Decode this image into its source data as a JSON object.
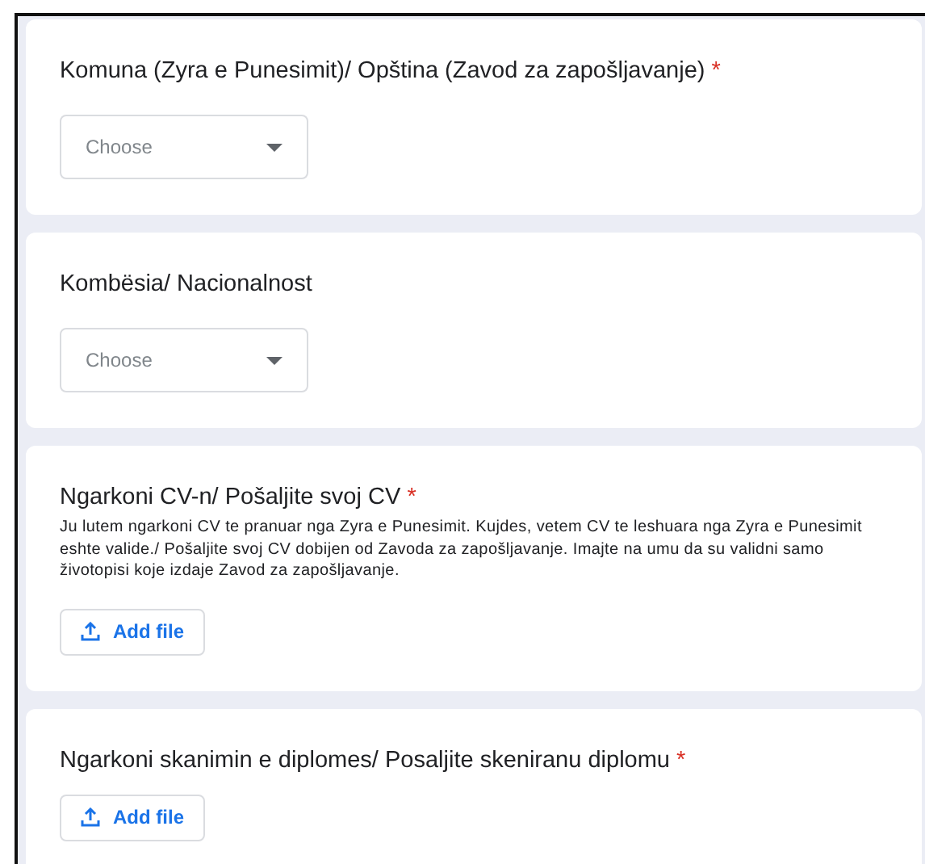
{
  "questions": [
    {
      "kind": "dropdown",
      "title": "Komuna (Zyra e Punesimit)/ Opština (Zavod za zapošljavanje)",
      "required_mark": "*",
      "placeholder": "Choose"
    },
    {
      "kind": "dropdown",
      "title": "Kombësia/ Nacionalnost",
      "placeholder": "Choose"
    },
    {
      "kind": "file",
      "title": "Ngarkoni CV-n/ Pošaljite svoj CV",
      "required_mark": "*",
      "description": "Ju lutem ngarkoni CV te pranuar nga Zyra e Punesimit. Kujdes, vetem CV te leshuara nga Zyra e Punesimit eshte valide./ Pošaljite svoj CV dobijen od Zavoda za zapošljavanje. Imajte na umu da su validni samo životopisi koje izdaje Zavod za zapošljavanje.",
      "button": "Add file"
    },
    {
      "kind": "file",
      "title": "Ngarkoni skanimin e diplomes/ Posaljite skeniranu diplomu",
      "required_mark": "*",
      "button": "Add file"
    }
  ]
}
